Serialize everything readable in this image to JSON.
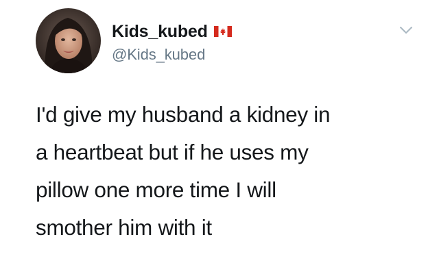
{
  "author": {
    "display_name": "Kids_kubed",
    "handle": "@Kids_kubed",
    "badge_icon": "canada-flag-icon",
    "avatar_icon": "profile-photo-avatar"
  },
  "menu": {
    "icon": "chevron-down-icon"
  },
  "tweet": {
    "lines": [
      "I'd give my husband a kidney in",
      "a heartbeat but if he uses my",
      "pillow one more time I will",
      "smother him with it"
    ]
  },
  "colors": {
    "background": "#ffffff",
    "text_primary": "#14171a",
    "text_secondary": "#657786",
    "flag_red": "#d52b1e",
    "chevron": "#aab8c2"
  }
}
